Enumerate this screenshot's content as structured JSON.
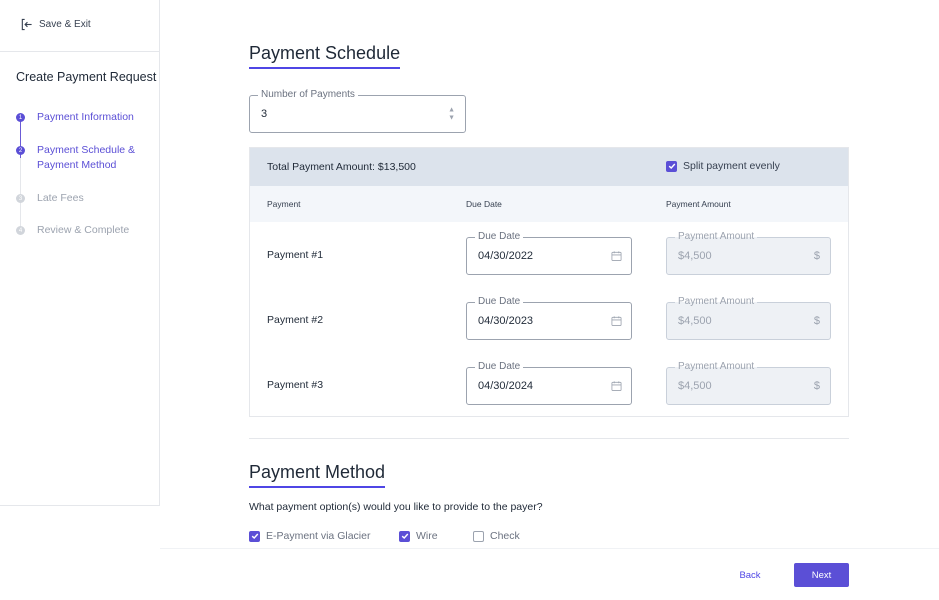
{
  "sidebar": {
    "save_exit_label": "Save & Exit",
    "title": "Create Payment Request",
    "steps": [
      {
        "number": "1",
        "label": "Payment Information",
        "state": "active"
      },
      {
        "number": "2",
        "label": "Payment Schedule & Payment Method",
        "state": "active"
      },
      {
        "number": "3",
        "label": "Late Fees",
        "state": "inactive"
      },
      {
        "number": "4",
        "label": "Review & Complete",
        "state": "inactive"
      }
    ]
  },
  "schedule": {
    "title": "Payment Schedule",
    "num_payments_label": "Number of Payments",
    "num_payments_value": "3",
    "total_label": "Total Payment Amount: $13,500",
    "split_label": "Split payment evenly",
    "split_checked": true,
    "columns": [
      "Payment",
      "Due Date",
      "Payment Amount"
    ],
    "rows": [
      {
        "label": "Payment #1",
        "date_legend": "Due Date",
        "date": "04/30/2022",
        "amount_legend": "Payment Amount",
        "amount": "$4,500",
        "currency": "$"
      },
      {
        "label": "Payment #2",
        "date_legend": "Due Date",
        "date": "04/30/2023",
        "amount_legend": "Payment Amount",
        "amount": "$4,500",
        "currency": "$"
      },
      {
        "label": "Payment #3",
        "date_legend": "Due Date",
        "date": "04/30/2024",
        "amount_legend": "Payment Amount",
        "amount": "$4,500",
        "currency": "$"
      }
    ]
  },
  "method": {
    "title": "Payment Method",
    "question": "What payment option(s) would you like to provide to the payer?",
    "options": [
      {
        "label": "E-Payment via Glacier",
        "checked": true
      },
      {
        "label": "Wire",
        "checked": true
      },
      {
        "label": "Check",
        "checked": false
      }
    ]
  },
  "footer": {
    "back_label": "Back",
    "next_label": "Next"
  },
  "colors": {
    "accent": "#5b4fd6",
    "table_header_bg": "#dce3ec",
    "disabled_field_bg": "#eef1f5"
  }
}
